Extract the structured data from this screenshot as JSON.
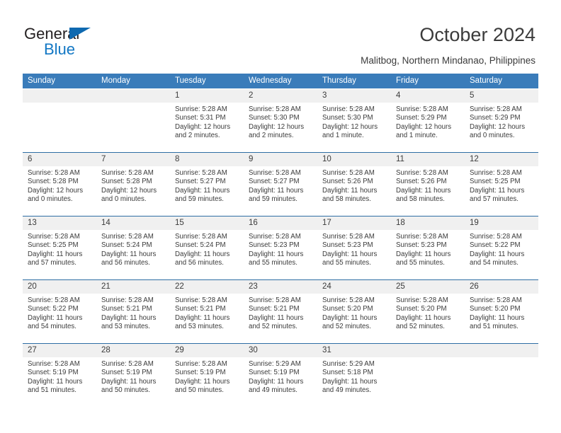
{
  "brand": {
    "name_top": "General",
    "name_bottom": "Blue",
    "accent_color": "#1277c4",
    "triangle_color": "#0e69b0"
  },
  "header": {
    "title": "October 2024",
    "subtitle": "Malitbog, Northern Mindanao, Philippines",
    "header_bg": "#3a7cba",
    "header_text_color": "#ffffff",
    "row_divider_color": "#2e6da4",
    "daynum_bar_color": "#f0f0f0"
  },
  "weekday_headers": [
    "Sunday",
    "Monday",
    "Tuesday",
    "Wednesday",
    "Thursday",
    "Friday",
    "Saturday"
  ],
  "weeks": [
    [
      {
        "day": "",
        "empty": true,
        "sunrise": "",
        "sunset": "",
        "daylight_1": "",
        "daylight_2": ""
      },
      {
        "day": "",
        "empty": true,
        "sunrise": "",
        "sunset": "",
        "daylight_1": "",
        "daylight_2": ""
      },
      {
        "day": "1",
        "empty": false,
        "sunrise": "Sunrise: 5:28 AM",
        "sunset": "Sunset: 5:31 PM",
        "daylight_1": "Daylight: 12 hours",
        "daylight_2": "and 2 minutes."
      },
      {
        "day": "2",
        "empty": false,
        "sunrise": "Sunrise: 5:28 AM",
        "sunset": "Sunset: 5:30 PM",
        "daylight_1": "Daylight: 12 hours",
        "daylight_2": "and 2 minutes."
      },
      {
        "day": "3",
        "empty": false,
        "sunrise": "Sunrise: 5:28 AM",
        "sunset": "Sunset: 5:30 PM",
        "daylight_1": "Daylight: 12 hours",
        "daylight_2": "and 1 minute."
      },
      {
        "day": "4",
        "empty": false,
        "sunrise": "Sunrise: 5:28 AM",
        "sunset": "Sunset: 5:29 PM",
        "daylight_1": "Daylight: 12 hours",
        "daylight_2": "and 1 minute."
      },
      {
        "day": "5",
        "empty": false,
        "sunrise": "Sunrise: 5:28 AM",
        "sunset": "Sunset: 5:29 PM",
        "daylight_1": "Daylight: 12 hours",
        "daylight_2": "and 0 minutes."
      }
    ],
    [
      {
        "day": "6",
        "empty": false,
        "sunrise": "Sunrise: 5:28 AM",
        "sunset": "Sunset: 5:28 PM",
        "daylight_1": "Daylight: 12 hours",
        "daylight_2": "and 0 minutes."
      },
      {
        "day": "7",
        "empty": false,
        "sunrise": "Sunrise: 5:28 AM",
        "sunset": "Sunset: 5:28 PM",
        "daylight_1": "Daylight: 12 hours",
        "daylight_2": "and 0 minutes."
      },
      {
        "day": "8",
        "empty": false,
        "sunrise": "Sunrise: 5:28 AM",
        "sunset": "Sunset: 5:27 PM",
        "daylight_1": "Daylight: 11 hours",
        "daylight_2": "and 59 minutes."
      },
      {
        "day": "9",
        "empty": false,
        "sunrise": "Sunrise: 5:28 AM",
        "sunset": "Sunset: 5:27 PM",
        "daylight_1": "Daylight: 11 hours",
        "daylight_2": "and 59 minutes."
      },
      {
        "day": "10",
        "empty": false,
        "sunrise": "Sunrise: 5:28 AM",
        "sunset": "Sunset: 5:26 PM",
        "daylight_1": "Daylight: 11 hours",
        "daylight_2": "and 58 minutes."
      },
      {
        "day": "11",
        "empty": false,
        "sunrise": "Sunrise: 5:28 AM",
        "sunset": "Sunset: 5:26 PM",
        "daylight_1": "Daylight: 11 hours",
        "daylight_2": "and 58 minutes."
      },
      {
        "day": "12",
        "empty": false,
        "sunrise": "Sunrise: 5:28 AM",
        "sunset": "Sunset: 5:25 PM",
        "daylight_1": "Daylight: 11 hours",
        "daylight_2": "and 57 minutes."
      }
    ],
    [
      {
        "day": "13",
        "empty": false,
        "sunrise": "Sunrise: 5:28 AM",
        "sunset": "Sunset: 5:25 PM",
        "daylight_1": "Daylight: 11 hours",
        "daylight_2": "and 57 minutes."
      },
      {
        "day": "14",
        "empty": false,
        "sunrise": "Sunrise: 5:28 AM",
        "sunset": "Sunset: 5:24 PM",
        "daylight_1": "Daylight: 11 hours",
        "daylight_2": "and 56 minutes."
      },
      {
        "day": "15",
        "empty": false,
        "sunrise": "Sunrise: 5:28 AM",
        "sunset": "Sunset: 5:24 PM",
        "daylight_1": "Daylight: 11 hours",
        "daylight_2": "and 56 minutes."
      },
      {
        "day": "16",
        "empty": false,
        "sunrise": "Sunrise: 5:28 AM",
        "sunset": "Sunset: 5:23 PM",
        "daylight_1": "Daylight: 11 hours",
        "daylight_2": "and 55 minutes."
      },
      {
        "day": "17",
        "empty": false,
        "sunrise": "Sunrise: 5:28 AM",
        "sunset": "Sunset: 5:23 PM",
        "daylight_1": "Daylight: 11 hours",
        "daylight_2": "and 55 minutes."
      },
      {
        "day": "18",
        "empty": false,
        "sunrise": "Sunrise: 5:28 AM",
        "sunset": "Sunset: 5:23 PM",
        "daylight_1": "Daylight: 11 hours",
        "daylight_2": "and 55 minutes."
      },
      {
        "day": "19",
        "empty": false,
        "sunrise": "Sunrise: 5:28 AM",
        "sunset": "Sunset: 5:22 PM",
        "daylight_1": "Daylight: 11 hours",
        "daylight_2": "and 54 minutes."
      }
    ],
    [
      {
        "day": "20",
        "empty": false,
        "sunrise": "Sunrise: 5:28 AM",
        "sunset": "Sunset: 5:22 PM",
        "daylight_1": "Daylight: 11 hours",
        "daylight_2": "and 54 minutes."
      },
      {
        "day": "21",
        "empty": false,
        "sunrise": "Sunrise: 5:28 AM",
        "sunset": "Sunset: 5:21 PM",
        "daylight_1": "Daylight: 11 hours",
        "daylight_2": "and 53 minutes."
      },
      {
        "day": "22",
        "empty": false,
        "sunrise": "Sunrise: 5:28 AM",
        "sunset": "Sunset: 5:21 PM",
        "daylight_1": "Daylight: 11 hours",
        "daylight_2": "and 53 minutes."
      },
      {
        "day": "23",
        "empty": false,
        "sunrise": "Sunrise: 5:28 AM",
        "sunset": "Sunset: 5:21 PM",
        "daylight_1": "Daylight: 11 hours",
        "daylight_2": "and 52 minutes."
      },
      {
        "day": "24",
        "empty": false,
        "sunrise": "Sunrise: 5:28 AM",
        "sunset": "Sunset: 5:20 PM",
        "daylight_1": "Daylight: 11 hours",
        "daylight_2": "and 52 minutes."
      },
      {
        "day": "25",
        "empty": false,
        "sunrise": "Sunrise: 5:28 AM",
        "sunset": "Sunset: 5:20 PM",
        "daylight_1": "Daylight: 11 hours",
        "daylight_2": "and 52 minutes."
      },
      {
        "day": "26",
        "empty": false,
        "sunrise": "Sunrise: 5:28 AM",
        "sunset": "Sunset: 5:20 PM",
        "daylight_1": "Daylight: 11 hours",
        "daylight_2": "and 51 minutes."
      }
    ],
    [
      {
        "day": "27",
        "empty": false,
        "sunrise": "Sunrise: 5:28 AM",
        "sunset": "Sunset: 5:19 PM",
        "daylight_1": "Daylight: 11 hours",
        "daylight_2": "and 51 minutes."
      },
      {
        "day": "28",
        "empty": false,
        "sunrise": "Sunrise: 5:28 AM",
        "sunset": "Sunset: 5:19 PM",
        "daylight_1": "Daylight: 11 hours",
        "daylight_2": "and 50 minutes."
      },
      {
        "day": "29",
        "empty": false,
        "sunrise": "Sunrise: 5:28 AM",
        "sunset": "Sunset: 5:19 PM",
        "daylight_1": "Daylight: 11 hours",
        "daylight_2": "and 50 minutes."
      },
      {
        "day": "30",
        "empty": false,
        "sunrise": "Sunrise: 5:29 AM",
        "sunset": "Sunset: 5:19 PM",
        "daylight_1": "Daylight: 11 hours",
        "daylight_2": "and 49 minutes."
      },
      {
        "day": "31",
        "empty": false,
        "sunrise": "Sunrise: 5:29 AM",
        "sunset": "Sunset: 5:18 PM",
        "daylight_1": "Daylight: 11 hours",
        "daylight_2": "and 49 minutes."
      },
      {
        "day": "",
        "empty": true,
        "sunrise": "",
        "sunset": "",
        "daylight_1": "",
        "daylight_2": ""
      },
      {
        "day": "",
        "empty": true,
        "sunrise": "",
        "sunset": "",
        "daylight_1": "",
        "daylight_2": ""
      }
    ]
  ]
}
